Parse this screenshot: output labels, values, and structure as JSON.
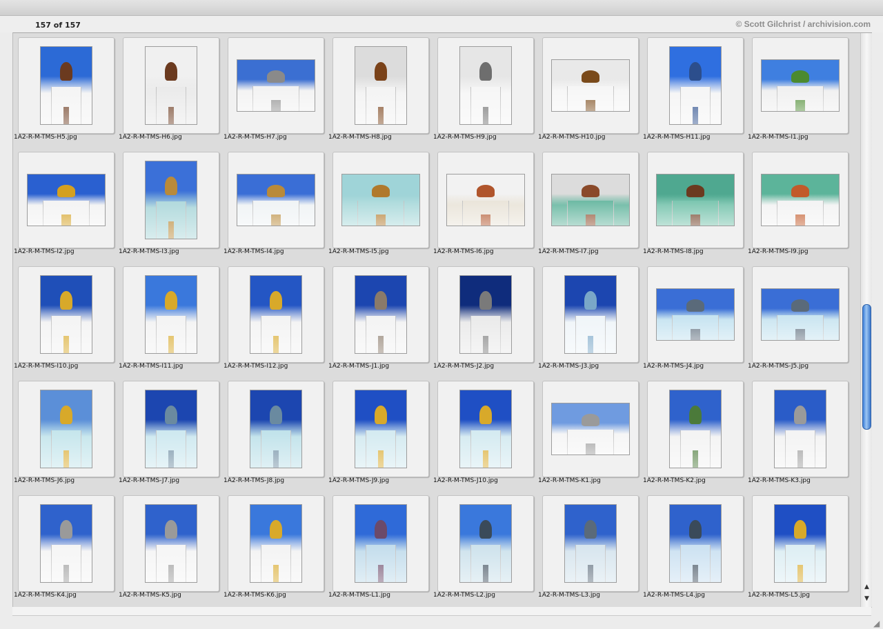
{
  "header": {
    "count": "157 of 157",
    "copyright": "© Scott Gilchrist / archivision.com"
  },
  "scrollbar": {
    "up_glyph": "▲",
    "down_glyph": "▼",
    "position": 0.68
  },
  "resize_glyph": "◢",
  "items": [
    {
      "label": "1A2-R-M-TMS-H5.jpg",
      "orient": "portrait",
      "sky": "#2c6ad6",
      "wall": "#f3f3f3",
      "accent": "#6b3a1f"
    },
    {
      "label": "1A2-R-M-TMS-H6.jpg",
      "orient": "portrait",
      "sky": "#f0f0f0",
      "wall": "#e8e8e8",
      "accent": "#6b3a1f"
    },
    {
      "label": "1A2-R-M-TMS-H7.jpg",
      "orient": "landscape",
      "sky": "#3b6fd2",
      "wall": "#f1f1f1",
      "accent": "#8a8a8a"
    },
    {
      "label": "1A2-R-M-TMS-H8.jpg",
      "orient": "portrait",
      "sky": "#dcdcdc",
      "wall": "#f2f2f2",
      "accent": "#7a4219"
    },
    {
      "label": "1A2-R-M-TMS-H9.jpg",
      "orient": "portrait",
      "sky": "#e6e6e6",
      "wall": "#f5f5f5",
      "accent": "#6e6e6e"
    },
    {
      "label": "1A2-R-M-TMS-H10.jpg",
      "orient": "landscape",
      "sky": "#e9e9e9",
      "wall": "#f5f5f5",
      "accent": "#7a4a1a"
    },
    {
      "label": "1A2-R-M-TMS-H11.jpg",
      "orient": "portrait",
      "sky": "#2f6fe0",
      "wall": "#f4f4f4",
      "accent": "#2c4e8c"
    },
    {
      "label": "1A2-R-M-TMS-I1.jpg",
      "orient": "landscape",
      "sky": "#3f7fe0",
      "wall": "#eeeeee",
      "accent": "#4b8a2f"
    },
    {
      "label": "1A2-R-M-TMS-I2.jpg",
      "orient": "landscape",
      "sky": "#2a60d0",
      "wall": "#f2f2f2",
      "accent": "#d4a020"
    },
    {
      "label": "1A2-R-M-TMS-I3.jpg",
      "orient": "portrait",
      "sky": "#3b70d8",
      "wall": "#a9d6d9",
      "accent": "#b98a3a"
    },
    {
      "label": "1A2-R-M-TMS-I4.jpg",
      "orient": "landscape",
      "sky": "#3a6ed6",
      "wall": "#eef2f4",
      "accent": "#b98a3a"
    },
    {
      "label": "1A2-R-M-TMS-I5.jpg",
      "orient": "landscape",
      "sky": "#9fd4d8",
      "wall": "#a5d7d8",
      "accent": "#b0792c"
    },
    {
      "label": "1A2-R-M-TMS-I6.jpg",
      "orient": "landscape",
      "sky": "#f2f2f2",
      "wall": "#e8e2d6",
      "accent": "#b0552c"
    },
    {
      "label": "1A2-R-M-TMS-I7.jpg",
      "orient": "landscape",
      "sky": "#dcdcdc",
      "wall": "#5fb39b",
      "accent": "#8a4a2a"
    },
    {
      "label": "1A2-R-M-TMS-I8.jpg",
      "orient": "landscape",
      "sky": "#4fa890",
      "wall": "#6fc0a8",
      "accent": "#6b3a1f"
    },
    {
      "label": "1A2-R-M-TMS-I9.jpg",
      "orient": "landscape",
      "sky": "#5cb49a",
      "wall": "#f2f2f2",
      "accent": "#c25a2a"
    },
    {
      "label": "1A2-R-M-TMS-I10.jpg",
      "orient": "portrait",
      "sky": "#1f4fb8",
      "wall": "#f2f2f2",
      "accent": "#d8a92a"
    },
    {
      "label": "1A2-R-M-TMS-I11.jpg",
      "orient": "portrait",
      "sky": "#3a78dc",
      "wall": "#f2f2f2",
      "accent": "#d8a92a"
    },
    {
      "label": "1A2-R-M-TMS-I12.jpg",
      "orient": "portrait",
      "sky": "#2456c4",
      "wall": "#f2f2f2",
      "accent": "#d8a92a"
    },
    {
      "label": "1A2-R-M-TMS-J1.jpg",
      "orient": "portrait",
      "sky": "#1c46b0",
      "wall": "#f2f2f2",
      "accent": "#8a7a6a"
    },
    {
      "label": "1A2-R-M-TMS-J2.jpg",
      "orient": "portrait",
      "sky": "#0f2c7c",
      "wall": "#e8e8e8",
      "accent": "#7a7a7a"
    },
    {
      "label": "1A2-R-M-TMS-J3.jpg",
      "orient": "portrait",
      "sky": "#1c46b0",
      "wall": "#eef4f8",
      "accent": "#7aa7c8"
    },
    {
      "label": "1A2-R-M-TMS-J4.jpg",
      "orient": "landscape",
      "sky": "#3a6ed6",
      "wall": "#bfe0ef",
      "accent": "#5a6a7a"
    },
    {
      "label": "1A2-R-M-TMS-J5.jpg",
      "orient": "landscape",
      "sky": "#3a6ed6",
      "wall": "#c3e2ef",
      "accent": "#5a6a7a"
    },
    {
      "label": "1A2-R-M-TMS-J6.jpg",
      "orient": "portrait",
      "sky": "#5b8fd8",
      "wall": "#bfe3ea",
      "accent": "#d8a92a"
    },
    {
      "label": "1A2-R-M-TMS-J7.jpg",
      "orient": "portrait",
      "sky": "#1c46b0",
      "wall": "#c8e6ee",
      "accent": "#6a8aa0"
    },
    {
      "label": "1A2-R-M-TMS-J8.jpg",
      "orient": "portrait",
      "sky": "#1c46b0",
      "wall": "#b9dfe8",
      "accent": "#6a8aa0"
    },
    {
      "label": "1A2-R-M-TMS-J9.jpg",
      "orient": "portrait",
      "sky": "#1f4fc4",
      "wall": "#cfe8ef",
      "accent": "#d8a92a"
    },
    {
      "label": "1A2-R-M-TMS-J10.jpg",
      "orient": "portrait",
      "sky": "#1f4fc4",
      "wall": "#cfe8ef",
      "accent": "#d8a92a"
    },
    {
      "label": "1A2-R-M-TMS-K1.jpg",
      "orient": "landscape",
      "sky": "#6f9be0",
      "wall": "#f4f4f4",
      "accent": "#9a9a9a"
    },
    {
      "label": "1A2-R-M-TMS-K2.jpg",
      "orient": "portrait",
      "sky": "#2f62cc",
      "wall": "#f2f2f2",
      "accent": "#4b7a3a"
    },
    {
      "label": "1A2-R-M-TMS-K3.jpg",
      "orient": "portrait",
      "sky": "#2a5cc8",
      "wall": "#f2f2f2",
      "accent": "#9a9a9a"
    },
    {
      "label": "1A2-R-M-TMS-K4.jpg",
      "orient": "portrait",
      "sky": "#2f62cc",
      "wall": "#f4f4f4",
      "accent": "#9a9a9a"
    },
    {
      "label": "1A2-R-M-TMS-K5.jpg",
      "orient": "portrait",
      "sky": "#2f62cc",
      "wall": "#f4f4f4",
      "accent": "#9a9a9a"
    },
    {
      "label": "1A2-R-M-TMS-K6.jpg",
      "orient": "portrait",
      "sky": "#3a78dc",
      "wall": "#f2f2f2",
      "accent": "#d8a92a"
    },
    {
      "label": "1A2-R-M-TMS-L1.jpg",
      "orient": "portrait",
      "sky": "#2f6ad8",
      "wall": "#bcd9ea",
      "accent": "#6b4a6a"
    },
    {
      "label": "1A2-R-M-TMS-L2.jpg",
      "orient": "portrait",
      "sky": "#3a78dc",
      "wall": "#c8dfea",
      "accent": "#3a4a5a"
    },
    {
      "label": "1A2-R-M-TMS-L3.jpg",
      "orient": "portrait",
      "sky": "#2f62cc",
      "wall": "#d2e2ec",
      "accent": "#5a6a7a"
    },
    {
      "label": "1A2-R-M-TMS-L4.jpg",
      "orient": "portrait",
      "sky": "#2f62cc",
      "wall": "#c6def0",
      "accent": "#3a4a5a"
    },
    {
      "label": "1A2-R-M-TMS-L5.jpg",
      "orient": "portrait",
      "sky": "#1f4fc4",
      "wall": "#d9ecf2",
      "accent": "#d8a92a"
    }
  ]
}
